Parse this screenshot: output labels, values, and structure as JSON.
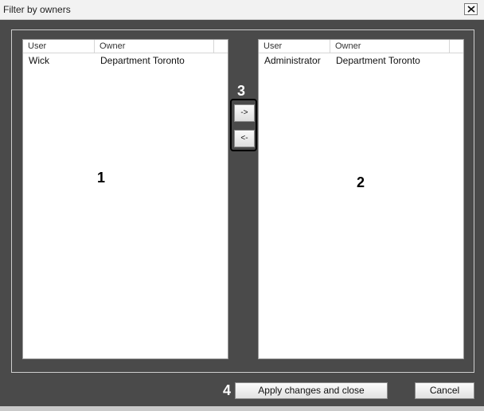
{
  "window": {
    "title": "Filter by owners"
  },
  "left_list": {
    "columns": [
      "User",
      "Owner"
    ],
    "rows": [
      {
        "user": "Wick",
        "owner": "Department Toronto"
      }
    ]
  },
  "right_list": {
    "columns": [
      "User",
      "Owner"
    ],
    "rows": [
      {
        "user": "Administrator",
        "owner": "Department Toronto"
      }
    ]
  },
  "move_buttons": {
    "right": "->",
    "left": "<-"
  },
  "actions": {
    "apply": "Apply changes and close",
    "cancel": "Cancel"
  },
  "callouts": {
    "left_list": "1",
    "right_list": "2",
    "move_buttons": "3",
    "apply": "4"
  },
  "icons": {
    "close": "close-icon"
  },
  "colors": {
    "background": "#4a4a4a",
    "panel": "#ffffff",
    "titlebar": "#f2f2f2"
  }
}
